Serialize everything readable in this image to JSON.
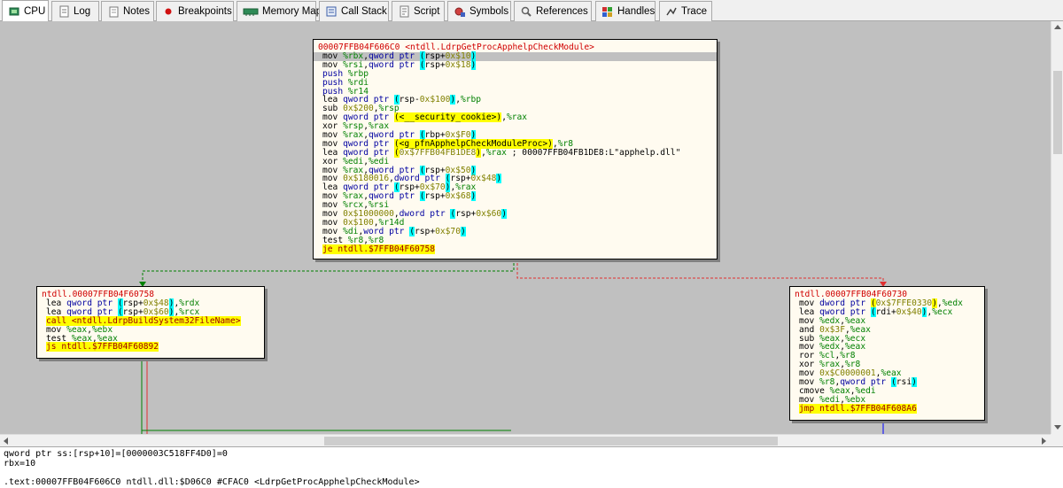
{
  "tabs": [
    {
      "label": "CPU",
      "icon": "cpu-icon"
    },
    {
      "label": "Log",
      "icon": "log-icon"
    },
    {
      "label": "Notes",
      "icon": "notes-icon"
    },
    {
      "label": "Breakpoints",
      "icon": "breakpoint-icon"
    },
    {
      "label": "Memory Map",
      "icon": "memory-map-icon"
    },
    {
      "label": "Call Stack",
      "icon": "call-stack-icon"
    },
    {
      "label": "Script",
      "icon": "script-icon"
    },
    {
      "label": "Symbols",
      "icon": "symbols-icon"
    },
    {
      "label": "References",
      "icon": "references-icon"
    },
    {
      "label": "Handles",
      "icon": "handles-icon"
    },
    {
      "label": "Trace",
      "icon": "trace-icon"
    }
  ],
  "active_tab": "CPU",
  "blocks": {
    "main": {
      "header": "00007FFB04F606C0 <ntdll.LdrpGetProcApphelpCheckModule>",
      "lines": [
        "mov %rbx,qword ptr (rsp+0x$10)",
        "mov %rsi,qword ptr (rsp+0x$18)",
        "push %rbp",
        "push %rdi",
        "push %r14",
        "lea qword ptr (rsp-0x$100),%rbp",
        "sub 0x$200,%rsp",
        "mov qword ptr (<__security_cookie>),%rax",
        "xor %rsp,%rax",
        "mov %rax,qword ptr (rbp+0x$F0)",
        "mov qword ptr (<g_pfnApphelpCheckModuleProc>),%r8",
        "lea qword ptr (0x$7FFB04FB1DE8),%rax ; 00007FFB04FB1DE8:L\"apphelp.dll\"",
        "xor %edi,%edi",
        "mov %rax,qword ptr (rsp+0x$50)",
        "mov 0x$180016,dword ptr (rsp+0x$48)",
        "lea qword ptr (rsp+0x$70),%rax",
        "mov %rax,qword ptr (rsp+0x$68)",
        "mov %rcx,%rsi",
        "mov 0x$1000000,dword ptr (rsp+0x$60)",
        "mov 0x$100,%r14d",
        "mov %di,word ptr (rsp+0x$70)",
        "test %r8,%r8",
        "je ntdll.$7FFB04F60758"
      ]
    },
    "left": {
      "header": "ntdll.00007FFB04F60758",
      "lines": [
        "lea qword ptr (rsp+0x$48),%rdx",
        "lea qword ptr (rsp+0x$60),%rcx",
        "call <ntdll.LdrpBuildSystem32FileName>",
        "mov %eax,%ebx",
        "test %eax,%eax",
        "js ntdll.$7FFB04F60892"
      ]
    },
    "right": {
      "header": "ntdll.00007FFB04F60730",
      "lines": [
        "mov dword ptr (0x$7FFE0330),%edx",
        "lea qword ptr (rdi+0x$40),%ecx",
        "mov %edx,%eax",
        "and 0x$3F,%eax",
        "sub %eax,%ecx",
        "mov %edx,%eax",
        "ror %cl,%r8",
        "xor %rax,%r8",
        "mov 0x$C0000001,%eax",
        "mov %r8,qword ptr (rsi)",
        "cmove %eax,%edi",
        "mov %edi,%ebx",
        "jmp ntdll.$7FFB04F608A6"
      ]
    }
  },
  "info": {
    "line1": "qword ptr ss:[rsp+10]=[0000003C518FF4D0]=0",
    "line2": "rbx=10",
    "line3": "",
    "line4": ".text:00007FFB04F606C0 ntdll.dll:$D06C0 #CFAC0 <LdrpGetProcApphelpCheckModule>"
  },
  "colors": {
    "graph_bg": "#c0c0c0",
    "block_bg": "#fffbf0",
    "header_red": "#d00000",
    "edge_true_green": "#008000",
    "edge_false_red": "#e03030",
    "edge_blue": "#0000ff"
  }
}
